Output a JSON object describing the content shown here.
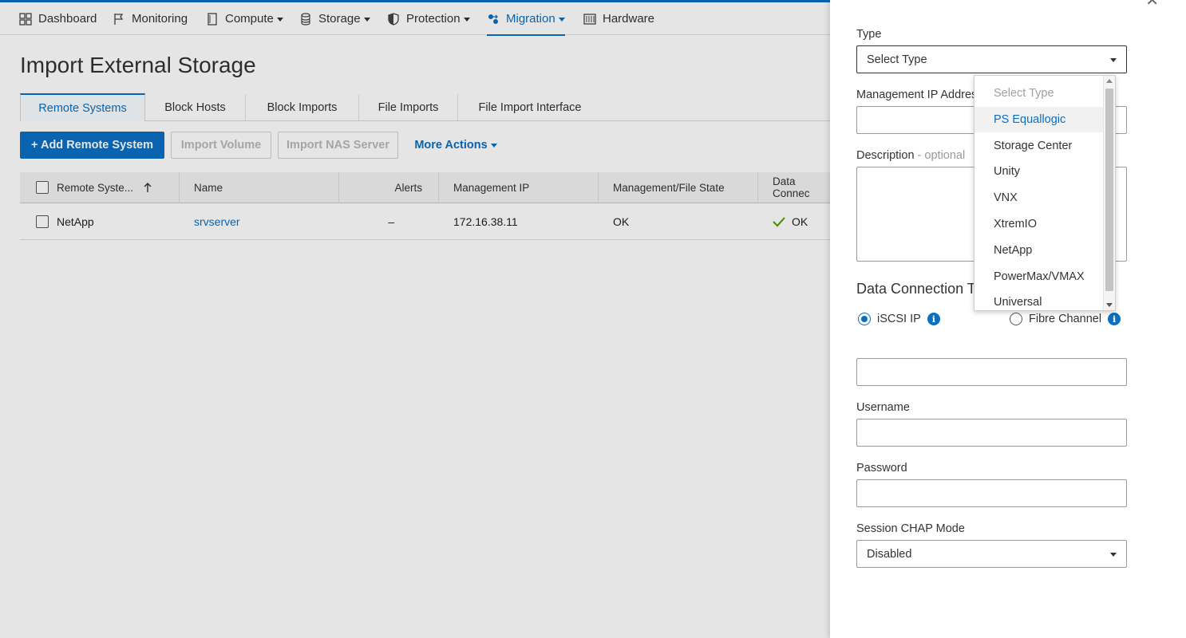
{
  "nav": {
    "items": [
      {
        "label": "Dashboard",
        "icon": "dashboard-grid-icon"
      },
      {
        "label": "Monitoring",
        "icon": "flag-icon"
      },
      {
        "label": "Compute",
        "icon": "compute-icon"
      },
      {
        "label": "Storage",
        "icon": "database-icon"
      },
      {
        "label": "Protection",
        "icon": "shield-icon"
      },
      {
        "label": "Migration",
        "icon": "migration-icon"
      },
      {
        "label": "Hardware",
        "icon": "hardware-icon"
      }
    ],
    "active": "Migration"
  },
  "page": {
    "title": "Import External Storage"
  },
  "tabs": [
    {
      "label": "Remote Systems"
    },
    {
      "label": "Block Hosts"
    },
    {
      "label": "Block Imports"
    },
    {
      "label": "File Imports"
    },
    {
      "label": "File Import Interface"
    }
  ],
  "toolbar": {
    "add_label": "+ Add Remote System",
    "import_volume_label": "Import Volume",
    "import_nas_label": "Import NAS Server",
    "more_actions_label": "More Actions"
  },
  "table": {
    "columns": [
      "Remote Syste...",
      "Name",
      "Alerts",
      "Management IP",
      "Management/File State",
      "Data Connec"
    ],
    "rows": [
      {
        "system": "NetApp",
        "name": "srvserver",
        "alerts": "–",
        "ip": "172.16.38.11",
        "state": "OK",
        "data_connection": "OK"
      }
    ]
  },
  "panel": {
    "type_label": "Type",
    "type_value": "Select Type",
    "mgmt_ip_label": "Management IP Addres",
    "description_label": "Description",
    "description_optional": " - optional",
    "data_connection_title": "Data Connection Ty",
    "iscsi_label": "iSCSI IP",
    "fc_label": "Fibre Channel",
    "username_label": "Username",
    "password_label": "Password",
    "chap_label": "Session CHAP Mode",
    "chap_value": "Disabled"
  },
  "dropdown": {
    "options": [
      "Select Type",
      "PS Equallogic",
      "Storage Center",
      "Unity",
      "VNX",
      "XtremIO",
      "NetApp",
      "PowerMax/VMAX",
      "Universal"
    ],
    "hovered": "PS Equallogic"
  },
  "colors": {
    "accent": "#0b6fc2",
    "ok": "#4e9a06"
  }
}
